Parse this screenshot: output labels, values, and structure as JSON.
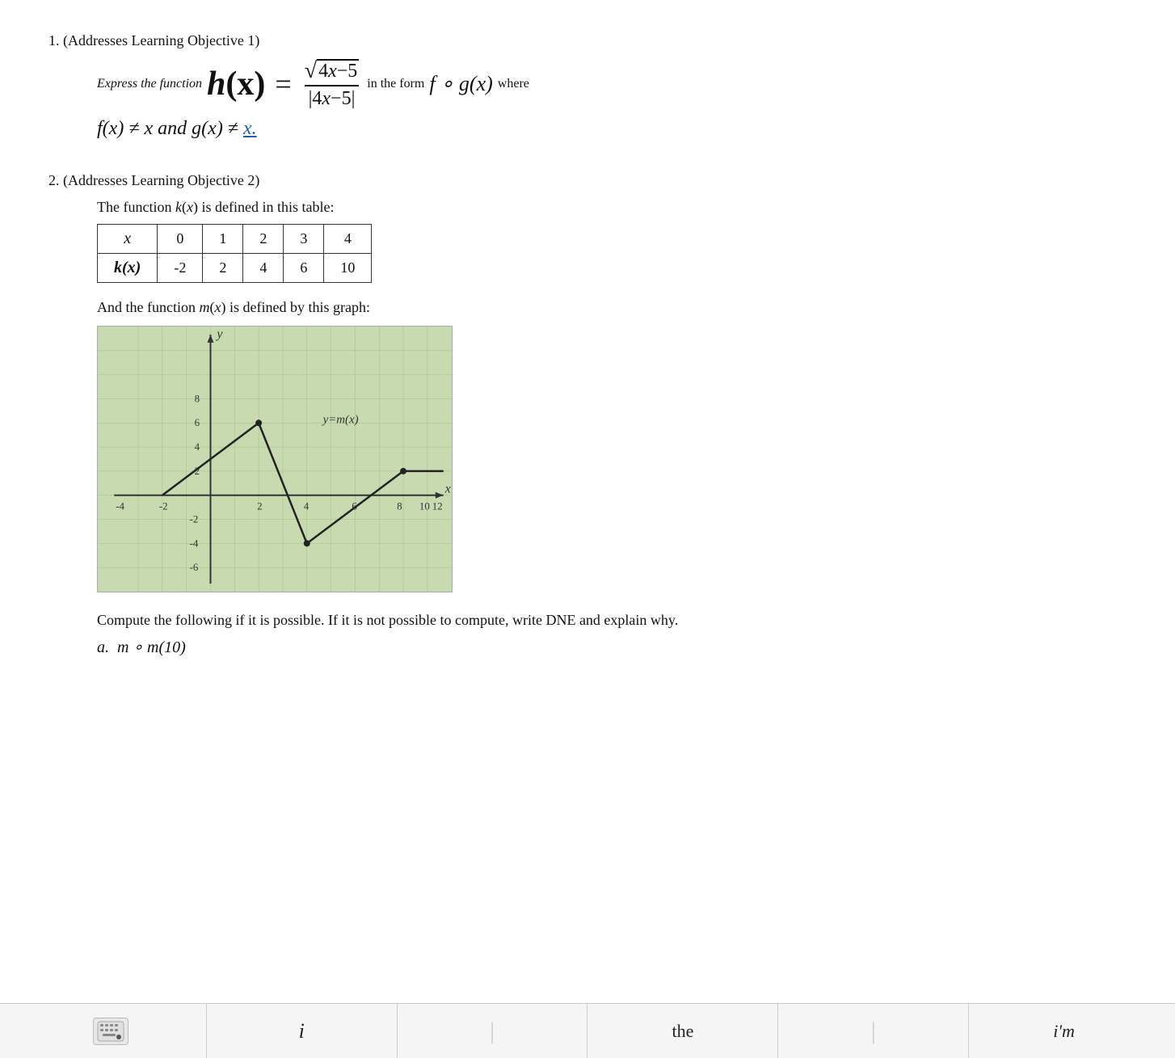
{
  "problem1": {
    "header": "1.   (Addresses Learning Objective 1)",
    "express_label": "Express the function",
    "h_of_x": "h(x)",
    "equals": "=",
    "fraction_num_sqrt": "√4x−5",
    "fraction_den": "|4x−5|",
    "in_form": "in the form",
    "fog": "f ∘ g(x)",
    "where": "where",
    "condition": "f(x) ≠ x and g(x) ≠ x."
  },
  "problem2": {
    "header": "2.   (Addresses Learning Objective 2)",
    "table_intro": "The function k(x) is defined in this table:",
    "table": {
      "headers": [
        "x",
        "0",
        "1",
        "2",
        "3",
        "4"
      ],
      "row_label": "k(x)",
      "row_values": [
        "-2",
        "2",
        "4",
        "6",
        "10"
      ]
    },
    "graph_label": "And the function m(x) is defined by this graph:",
    "compute_label": "Compute the following if it is possible.  If it is not possible to compute, write DNE and explain why.",
    "part_a_label": "a.  m ∘ m(10)"
  },
  "toolbar": {
    "keyboard_icon": "⌨",
    "letter": "i",
    "the": "the",
    "im": "i'm"
  }
}
